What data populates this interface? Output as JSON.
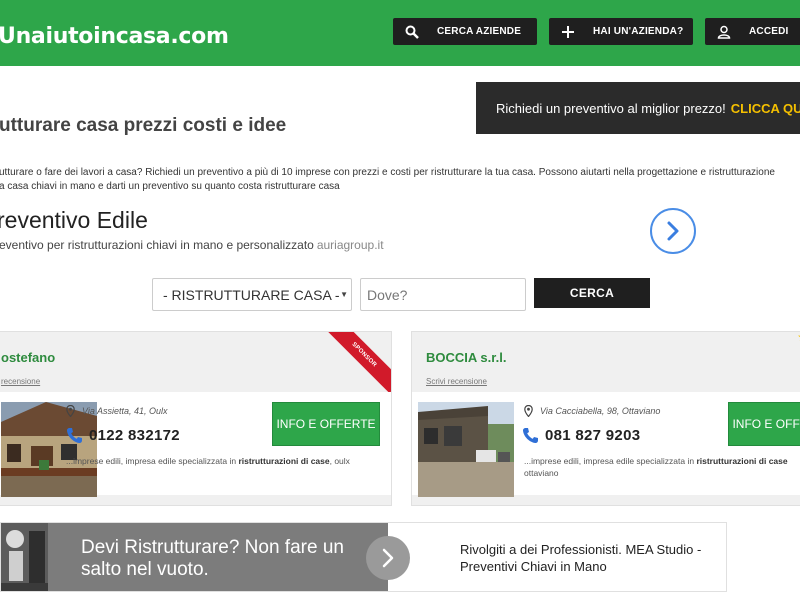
{
  "header": {
    "logo": "Unaiutoincasa.com",
    "buttons": {
      "search_companies": "CERCA AZIENDE",
      "have_company": "HAI UN'AZIENDA?",
      "login": "ACCEDI"
    }
  },
  "page": {
    "title": "utturare casa prezzi costi e idee",
    "intro_line1": "utturare o fare dei lavori a casa? Richiedi un preventivo a più di 10 imprese con prezzi e costi per ristrutturare la tua casa. Possono aiutarti nella progettazione e ristrutturazione",
    "intro_line2": "a casa chiavi in mano e darti un preventivo su quanto costa ristrutturare casa"
  },
  "promo": {
    "text": "Richiedi un preventivo al miglior prezzo!",
    "cta": "CLICCA QUI"
  },
  "ad": {
    "title": "reventivo Edile",
    "subtitle": "eventivo per ristrutturazioni chiavi in mano e personalizzato",
    "domain": "auriagroup.it",
    "arrow_icon": "chevron-right-icon"
  },
  "search": {
    "category": "- RISTRUTTURARE CASA -",
    "location_placeholder": "Dove?",
    "submit": "CERCA"
  },
  "listings": [
    {
      "name": "ostefano",
      "review_link": "recensione",
      "badge": "SPONSOR",
      "address": "Via Assietta, 41, Oulx",
      "phone": "0122 832172",
      "offer": "INFO E OFFERTE",
      "desc_prefix": "...imprese edili, impresa edile specializzata in ",
      "desc_bold": "ristrutturazioni di case",
      "desc_suffix": ", oulx"
    },
    {
      "name": "BOCCIA s.r.l.",
      "review_link": "Scrivi recensione",
      "address": "Via Cacciabella, 98, Ottaviano",
      "phone": "081 827 9203",
      "offer": "INFO E OFFERTE",
      "desc_prefix": "...imprese edili, impresa edile specializzata in ",
      "desc_bold": "ristrutturazioni di case",
      "desc_line2": "ottaviano"
    }
  ],
  "banner": {
    "headline": "Devi Ristrutturare? Non fare un salto nel vuoto.",
    "text": "Rivolgiti a dei Professionisti. MEA Studio - Preventivi Chiavi in Mano"
  },
  "colors": {
    "brand_green": "#2ea64a",
    "dark": "#1f1f1f",
    "accent_yellow": "#f5c000",
    "sponsor_red": "#d11a2a",
    "link_blue": "#4a8de6"
  }
}
